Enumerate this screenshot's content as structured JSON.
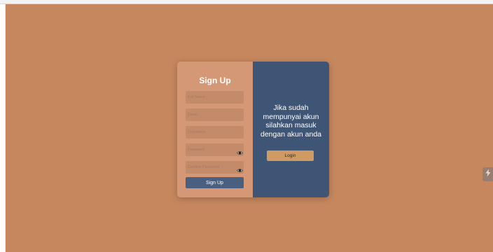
{
  "signup": {
    "title": "Sign Up",
    "fields": [
      {
        "name": "full-name-input",
        "placeholder": "Full Name",
        "value": ""
      },
      {
        "name": "email-input",
        "placeholder": "Email",
        "value": ""
      },
      {
        "name": "username-input",
        "placeholder": "Username",
        "value": ""
      },
      {
        "name": "password-input",
        "placeholder": "Password",
        "value": ""
      },
      {
        "name": "confirm-password-input",
        "placeholder": "Confirm Password",
        "value": ""
      }
    ],
    "button_label": "Sign Up"
  },
  "login": {
    "message": "Jika sudah mempunyai akun silahkan masuk dengan akun anda",
    "button_label": "Login"
  },
  "icons": {
    "password_toggle": "eye-icon",
    "confirm_password_toggle": "eye-icon",
    "side_widget": "lightning-icon"
  },
  "colors": {
    "background": "#c6875e",
    "signup_panel": "#d49876",
    "login_panel": "#3f5575",
    "signup_button": "#495f80",
    "login_button": "#d09a63"
  }
}
